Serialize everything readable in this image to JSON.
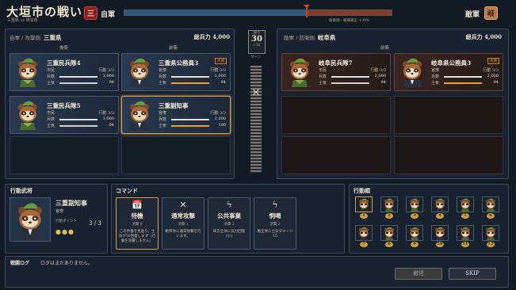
{
  "header": {
    "title": "大垣市の戦い",
    "subtitle": "三重県 vs 岐阜県",
    "ally_emblem": "三",
    "ally_label": "自軍",
    "enemy_label": "敵軍",
    "enemy_emblem": "岐",
    "balance": 0.68,
    "note": "防衛側・戦場補正 +30%"
  },
  "ally": {
    "role": "自軍 / 攻撃側",
    "pref": "三重県",
    "power_label": "総兵力 4,000",
    "back": "後衛",
    "front": "前衛",
    "units": [
      {
        "name": "三重民兵隊4",
        "type": "市民",
        "action": "行動 3/3",
        "troops": "兵数",
        "tval": "1,000",
        "morale": "士気",
        "mval": "94"
      },
      {
        "name": "三重県公務員3",
        "type": "官僚",
        "action": "行動 3/3",
        "troops": "兵数",
        "tval": "1,000",
        "morale": "士気",
        "mval": "94",
        "tag": "大将"
      },
      {
        "name": "三重民兵隊5",
        "type": "市民",
        "action": "行動 3/3",
        "troops": "兵数",
        "tval": "1,000",
        "morale": "士気",
        "mval": "94"
      },
      {
        "name": "三重副知事",
        "type": "官僚",
        "action": "行動 3/3",
        "troops": "兵数",
        "tval": "1,000",
        "morale": "士気",
        "mval": "100"
      }
    ]
  },
  "enemy": {
    "role": "敵軍 / 防衛側",
    "pref": "岐阜県",
    "power_label": "総兵力 4,000",
    "front": "前衛",
    "units": [
      {
        "name": "岐阜民兵隊7",
        "type": "市民",
        "action": "行動 3/3",
        "troops": "兵数",
        "tval": "2,000",
        "morale": "士気",
        "mval": "94"
      },
      {
        "name": "岐阜県公務員3",
        "type": "官僚",
        "action": "行動 3/3",
        "troops": "兵数",
        "tval": "2,000",
        "morale": "士気",
        "mval": "94",
        "tag": "大将"
      }
    ]
  },
  "turn": {
    "label": "残り",
    "value": "30",
    "sub": "/ 30",
    "unit": "ターン"
  },
  "actor": {
    "section": "行動武将",
    "name": "三重副知事",
    "type": "官僚",
    "points_label": "行動ポイント",
    "points": "3 / 3"
  },
  "commands": {
    "section": "コマンド",
    "items": [
      {
        "icon": "📅",
        "name": "待機",
        "cost": "消費 0",
        "desc": "この手番を見送り、士気が50回復します（行動を消費しません）"
      },
      {
        "icon": "✕",
        "name": "通常攻撃",
        "cost": "消費 1",
        "desc": "敵単体に通常攻撃を行います。"
      },
      {
        "icon": "ϟ",
        "name": "公共事業",
        "cost": "消費 2",
        "desc": "味方全体に兵力回復(小)"
      },
      {
        "icon": "ϟ",
        "name": "恫喝",
        "cost": "消費 2",
        "desc": "敵全体に士気ダメージ 15"
      }
    ]
  },
  "order": {
    "section": "行動順",
    "nums": [
      "1",
      "2",
      "3",
      "4",
      "5",
      "6",
      "7",
      "8",
      "9",
      "10",
      "11",
      "12"
    ]
  },
  "log": {
    "section": "戦闘ログ",
    "text": "ログはまだありません。"
  },
  "buttons": {
    "retreat": "撤退",
    "skip": "SKIP"
  }
}
